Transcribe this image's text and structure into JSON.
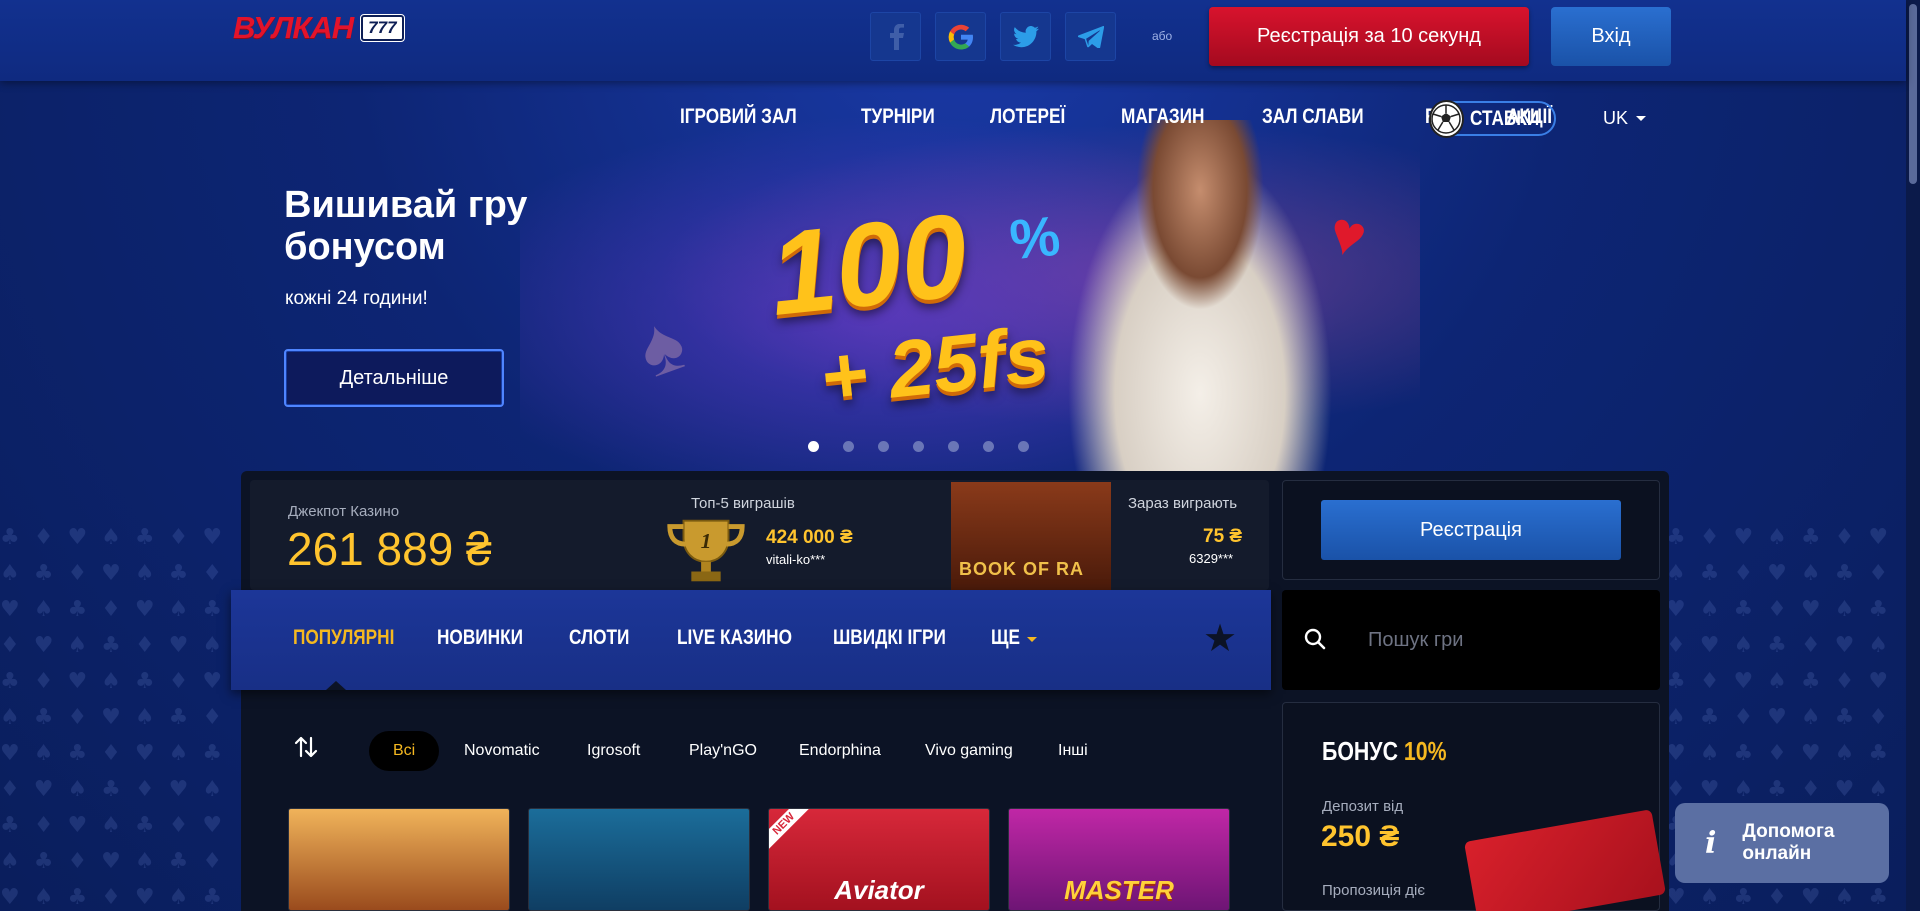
{
  "header": {
    "logo_text": "ВУЛКАН",
    "logo_badge": "777",
    "social_icons": [
      "facebook-icon",
      "google-icon",
      "twitter-icon",
      "telegram-icon"
    ],
    "or_text": "або",
    "register_label": "Реєстрація за 10 секунд",
    "login_label": "Вхід"
  },
  "nav": {
    "items": [
      "ІГРОВИЙ ЗАЛ",
      "ТУРНІРИ",
      "ЛОТЕРЕЇ",
      "МАГАЗИН",
      "ЗАЛ СЛАВИ",
      "FAQ",
      "АКЦІЇ"
    ],
    "bets_label": "СТАВКИ",
    "language": "UK"
  },
  "hero": {
    "title": "Вишивай гру бонусом",
    "subtitle": "кожні 24 години!",
    "button_label": "Детальніше",
    "promo_main": "100",
    "promo_pct": "%",
    "promo_fs": "+ 25fs",
    "slides_total": 7,
    "slides_active": 1
  },
  "jackpot": {
    "label": "Джекпот Казино",
    "value": "261 889 ₴"
  },
  "top5": {
    "label": "Топ-5 виграшів",
    "rank": "1",
    "amount": "424 000 ₴",
    "user": "vitali-ko***"
  },
  "now_winning": {
    "label": "Зараз виграють",
    "game": "BOOK OF RA",
    "amount": "75 ₴",
    "user": "6329***"
  },
  "sidebar": {
    "register_label": "Реєстрація",
    "search_placeholder": "Пошук гри",
    "bonus_title": "БОНУС",
    "bonus_pct": "10%",
    "deposit_label": "Депозит від",
    "deposit_value": "250 ₴",
    "offer_label": "Пропозиція діє"
  },
  "categories": {
    "tabs": [
      "ПОПУЛЯРНІ",
      "НОВИНКИ",
      "СЛОТИ",
      "LIVE КАЗИНО",
      "ШВИДКІ ІГРИ",
      "ЩЕ"
    ],
    "active": "ПОПУЛЯРНІ"
  },
  "providers": {
    "items": [
      "Всі",
      "Novomatic",
      "Igrosoft",
      "Play'nGO",
      "Endorphina",
      "Vivo gaming",
      "Інші"
    ],
    "active": "Всі"
  },
  "games": [
    {
      "title": ""
    },
    {
      "title": ""
    },
    {
      "title": "Aviator",
      "badge": "NEW"
    },
    {
      "title": "MASTER"
    }
  ],
  "help": {
    "label": "Допомога онлайн"
  },
  "colors": {
    "accent_gold": "#ffc42e",
    "register_red": "#d8132d",
    "login_blue": "#2a6fd0",
    "header_blue": "#12318f"
  }
}
